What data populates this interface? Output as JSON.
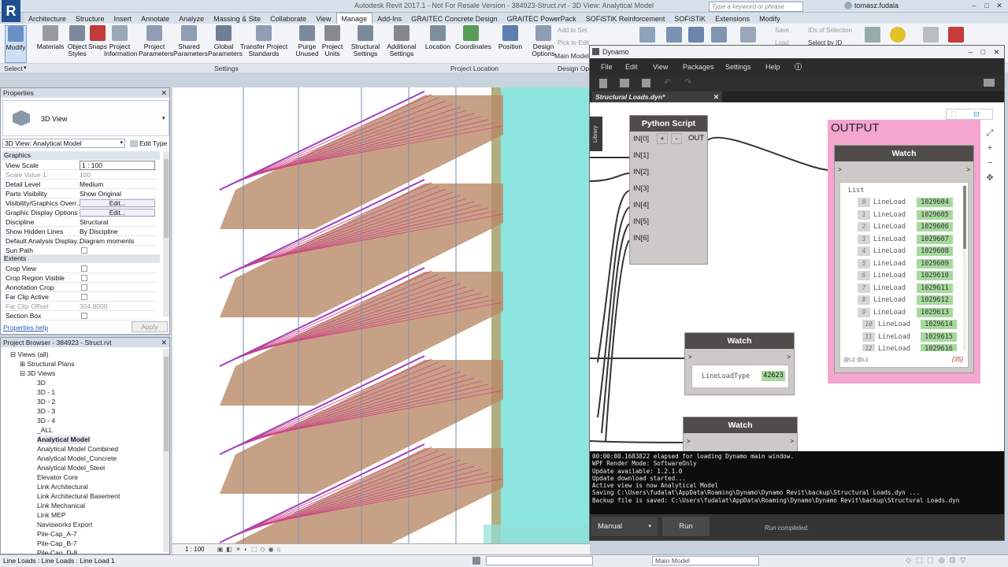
{
  "titlebar": {
    "logo": "R",
    "text": "Autodesk Revit 2017.1 -   Not For Resale Version  -   384923-Struct.rvt - 3D View: Analytical Model",
    "search_placeholder": "Type a keyword or phrase",
    "user": "tomasz.fudala"
  },
  "ribbon_tabs": [
    "Architecture",
    "Structure",
    "Insert",
    "Annotate",
    "Analyze",
    "Massing & Site",
    "Collaborate",
    "View",
    "Manage",
    "Add-Ins",
    "GRAITEC Concrete Design",
    "GRAITEC PowerPack",
    "SOFiSTiK Reinforcement",
    "SOFiSTiK",
    "Extensions",
    "Modify"
  ],
  "active_tab": "Manage",
  "tools": [
    {
      "label": "Modify",
      "color": "#6a8fc7"
    },
    {
      "label": "Materials",
      "color": "#9a9a9a"
    },
    {
      "label": "Object Styles",
      "color": "#7c8a9c"
    },
    {
      "label": "Snaps",
      "color": "#c23a3a"
    },
    {
      "label": "Project Information",
      "color": "#9aa7b8"
    },
    {
      "label": "Project Parameters",
      "color": "#8e9db3"
    },
    {
      "label": "Shared Parameters",
      "color": "#8e9db3"
    },
    {
      "label": "Global Parameters",
      "color": "#6f7f96"
    },
    {
      "label": "Transfer Project Standards",
      "color": "#8e9db3"
    },
    {
      "label": "Purge Unused",
      "color": "#7c8a9c"
    },
    {
      "label": "Project Units",
      "color": "#8a8a8a"
    },
    {
      "label": "Structural Settings",
      "color": "#7c8a9c"
    },
    {
      "label": "Additional Settings",
      "color": "#888"
    },
    {
      "label": "Location",
      "color": "#7b8f9e"
    },
    {
      "label": "Coordinates",
      "color": "#5a9a5a"
    },
    {
      "label": "Position",
      "color": "#5a7fb0"
    },
    {
      "label": "Design Options",
      "color": "#8e9db3"
    }
  ],
  "ribbon_groups": [
    "Select",
    "Settings",
    "Project Location",
    "Design Op"
  ],
  "ribbon_small": [
    "Add to Set",
    "Pick to Edit",
    "Main Model"
  ],
  "ribbon_right": [
    "Save",
    "Load",
    "IDs of  Selection",
    "Select  by ID"
  ],
  "properties": {
    "title": "Properties",
    "type": "3D View",
    "selector": "3D View: Analytical Model",
    "edit_type": "Edit Type",
    "sections": [
      "Graphics",
      "Extents"
    ],
    "rows": [
      {
        "k": "View Scale",
        "v": "1 : 100"
      },
      {
        "k": "Scale Value    1:",
        "v": "100"
      },
      {
        "k": "Detail Level",
        "v": "Medium"
      },
      {
        "k": "Parts Visibility",
        "v": "Show Original"
      },
      {
        "k": "Visibility/Graphics Overr...",
        "v": "Edit..."
      },
      {
        "k": "Graphic Display Options",
        "v": "Edit..."
      },
      {
        "k": "Discipline",
        "v": "Structural"
      },
      {
        "k": "Show Hidden Lines",
        "v": "By Discipline"
      },
      {
        "k": "Default Analysis Display...",
        "v": "Diagram moments"
      },
      {
        "k": "Sun Path",
        "v": ""
      },
      {
        "k": "Crop View",
        "v": ""
      },
      {
        "k": "Crop Region Visible",
        "v": ""
      },
      {
        "k": "Annotation Crop",
        "v": ""
      },
      {
        "k": "Far Clip Active",
        "v": ""
      },
      {
        "k": "Far Clip Offset",
        "v": "304.8000"
      },
      {
        "k": "Section Box",
        "v": ""
      }
    ],
    "help": "Properties help",
    "apply": "Apply"
  },
  "browser": {
    "title": "Project Browser - 384923 - Struct.rvt",
    "items": [
      "Views (all)",
      "Structural Plans",
      "3D Views",
      "3D",
      "3D - 1",
      "3D - 2",
      "3D - 3",
      "3D - 4",
      "_ALL",
      "Analytical Model",
      "Analytical Model Combined",
      "Analytical Model_Concrete",
      "Analytical Model_Steel",
      "Elevator Core",
      "Link Architectural",
      "Link Architectural Basement",
      "Link Mechanical",
      "Link MEP",
      "Navisworks Export",
      "Pile-Cap_A-7",
      "Pile-Cap_B-7",
      "Pile-Cap_D-8"
    ]
  },
  "viewbar": {
    "scale": "1 : 100"
  },
  "status": {
    "text": "Line Loads : Line Loads : Line Load 1",
    "model": "Main Model"
  },
  "dynamo": {
    "title": "Dynamo",
    "menu": [
      "File",
      "Edit",
      "View",
      "Packages",
      "Settings",
      "Help"
    ],
    "tab": "Structural Loads.dyn*",
    "library": "Library",
    "python": {
      "title": "Python Script",
      "ports": [
        "IN[0]",
        "IN[1]",
        "IN[2]",
        "IN[3]",
        "IN[4]",
        "IN[5]",
        "IN[6]"
      ],
      "plus": "+",
      "minus": "-",
      "out": "OUT"
    },
    "group_label": "OUTPUT",
    "watch_title": "Watch",
    "list": {
      "header": "List",
      "name": "LineLoad",
      "items": [
        {
          "i": "0",
          "v": "1029604"
        },
        {
          "i": "1",
          "v": "1029605"
        },
        {
          "i": "2",
          "v": "1029606"
        },
        {
          "i": "3",
          "v": "1029607"
        },
        {
          "i": "4",
          "v": "1029608"
        },
        {
          "i": "5",
          "v": "1029609"
        },
        {
          "i": "6",
          "v": "1029610"
        },
        {
          "i": "7",
          "v": "1029611"
        },
        {
          "i": "8",
          "v": "1029612"
        },
        {
          "i": "9",
          "v": "1029613"
        },
        {
          "i": "10",
          "v": "1029614"
        },
        {
          "i": "11",
          "v": "1029615"
        },
        {
          "i": "12",
          "v": "1029616"
        }
      ],
      "levels": "@L2 @L1",
      "count": "{35}"
    },
    "watch2": {
      "name": "LineLoadType",
      "value": "42623"
    },
    "console": [
      "00:00:00.1683822 elapsed for loading Dynamo main window.",
      "WPF Render Mode: SoftwareOnly",
      "Update available: 1.2.1.0",
      "Update download started...",
      "Active view is now Analytical Model",
      "Saving C:\\Users\\fudalat\\AppData\\Roaming\\Dynamo\\Dynamo Revit\\backup\\Structural Loads.dyn ...",
      "Backup file is saved: C:\\Users\\fudalat\\AppData\\Roaming\\Dynamo\\Dynamo Revit\\backup\\Structural Loads.dyn"
    ],
    "run_mode": "Manual",
    "run": "Run",
    "run_status": "Run completed."
  }
}
